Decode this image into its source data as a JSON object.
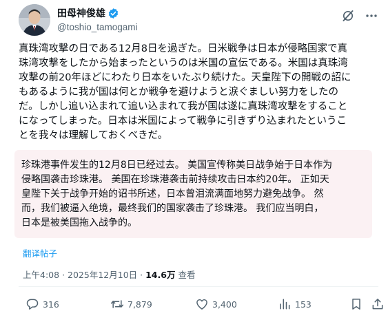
{
  "author": {
    "display_name": "田母神俊雄",
    "handle": "@toshio_tamogami",
    "verified_color": "#1d9bf0"
  },
  "header_icons": [
    "grok-icon",
    "more-icon"
  ],
  "tweet": {
    "lines": [
      "真珠湾攻撃の日である12月8日を過ぎた。日米戦争は日本が侵略国家で真",
      "珠湾攻撃をしたから始まったというのは米国の宣伝である。米国は真珠湾",
      "攻撃の前20年ほどにわたり日本をいたぶり続けた。天皇陛下の開戦の詔に",
      "もあるように我が国は何とか戦争を避けようと涙ぐましい努力をしたの",
      "だ。しかし追い込まれて追い込まれて我が国は遂に真珠湾攻撃をすること",
      "になってしまった。日本は米国によって戦争に引きずり込まれたというこ",
      "とを我々は理解しておくべきだ。"
    ]
  },
  "translation": {
    "lines": [
      "珍珠港事件发生的12月8日已经过去。 美国宣传称美日战争始于日本作为",
      "侵略国袭击珍珠港。 美国在珍珠港袭击前持续攻击日本约20年。 正如天",
      "皇陛下关于战争开始的诏书所述，日本曾泪流满面地努力避免战争。 然",
      "而，我们被逼入绝境，最终我们的国家袭击了珍珠港。 我们应当明白，",
      "日本是被美国拖入战争的。"
    ],
    "background": "#fbf1f3"
  },
  "translate_link": "翻译帖子",
  "meta": {
    "time": "上午4:08",
    "separator": "·",
    "date": "2025年12月10日",
    "views_count": "14.6万",
    "views_label": "查看"
  },
  "actions": {
    "replies": "316",
    "reposts": "7,879",
    "likes": "3,400",
    "views": "153"
  },
  "colors": {
    "text": "#0f1419",
    "secondary": "#536471",
    "accent": "#1d9bf0"
  }
}
